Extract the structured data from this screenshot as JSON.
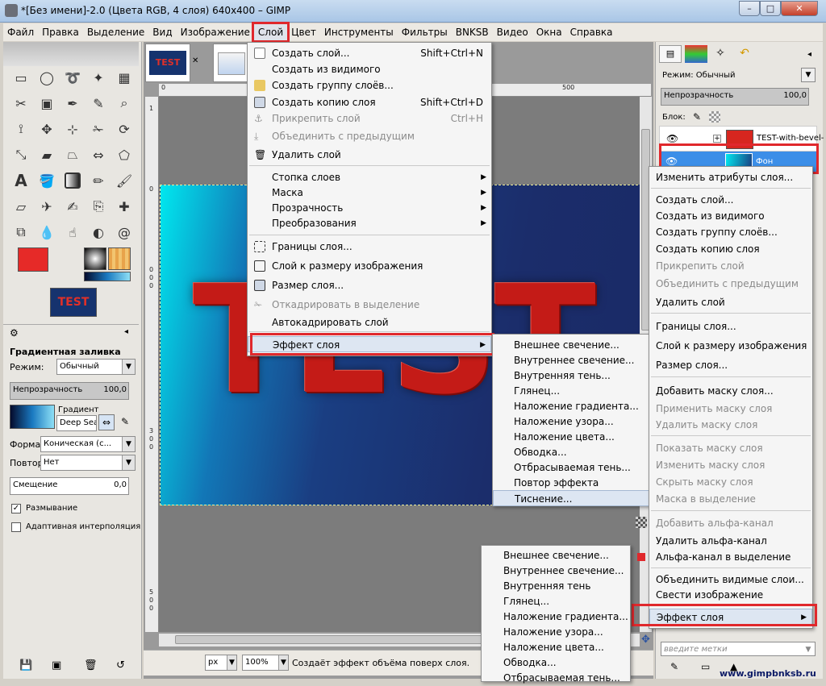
{
  "window": {
    "title": "*[Без имени]-2.0 (Цвета RGB, 4 слоя) 640x400 – GIMP",
    "min": "–",
    "max": "□",
    "close": "✕"
  },
  "menubar": [
    "Файл",
    "Правка",
    "Выделение",
    "Вид",
    "Изображение",
    "Слой",
    "Цвет",
    "Инструменты",
    "Фильтры",
    "BNKSB",
    "Видео",
    "Окна",
    "Справка"
  ],
  "canvas": {
    "image_text": "TEST",
    "ruler_h": [
      "0",
      "500"
    ],
    "ruler_v": [
      "1",
      "0",
      "0",
      "2",
      "0",
      "0",
      "3",
      "0",
      "0",
      "5",
      "0",
      "0"
    ],
    "tab_close": "✕"
  },
  "layer_menu": {
    "items": [
      {
        "label": "Создать слой...",
        "shortcut": "Shift+Ctrl+N"
      },
      {
        "label": "Создать из видимого",
        "shortcut": ""
      },
      {
        "label": "Создать группу слоёв...",
        "shortcut": ""
      },
      {
        "label": "Создать копию слоя",
        "shortcut": "Shift+Ctrl+D"
      },
      {
        "label": "Прикрепить слой",
        "shortcut": "Ctrl+H"
      },
      {
        "label": "Объединить с предыдущим",
        "shortcut": ""
      },
      {
        "label": "Удалить слой",
        "shortcut": ""
      },
      {
        "label": "Стопка слоев",
        "shortcut": ""
      },
      {
        "label": "Маска",
        "shortcut": ""
      },
      {
        "label": "Прозрачность",
        "shortcut": ""
      },
      {
        "label": "Преобразования",
        "shortcut": ""
      },
      {
        "label": "Границы слоя...",
        "shortcut": ""
      },
      {
        "label": "Слой к размеру изображения",
        "shortcut": ""
      },
      {
        "label": "Размер слоя...",
        "shortcut": ""
      },
      {
        "label": "Откадрировать в выделение",
        "shortcut": ""
      },
      {
        "label": "Автокадрировать слой",
        "shortcut": ""
      },
      {
        "label": "Эффект слоя",
        "shortcut": ""
      }
    ]
  },
  "effect_submenu_1": [
    "Внешнее свечение...",
    "Внутреннее свечение...",
    "Внутренняя тень...",
    "Глянец...",
    "Наложение градиента...",
    "Наложение узора...",
    "Наложение цвета...",
    "Обводка...",
    "Отбрасываемая тень...",
    "Повтор эффекта",
    "Тиснение..."
  ],
  "effect_submenu_2": [
    "Внешнее свечение...",
    "Внутреннее свечение...",
    "Внутренняя тень",
    "Глянец...",
    "Наложение градиента...",
    "Наложение узора...",
    "Наложение цвета...",
    "Обводка...",
    "Отбрасываемая тень..."
  ],
  "context_menu": [
    "Изменить атрибуты слоя...",
    "Создать слой...",
    "Создать из видимого",
    "Создать группу слоёв...",
    "Создать копию слоя",
    "Прикрепить слой",
    "Объединить с предыдущим",
    "Удалить слой",
    "Границы слоя...",
    "Слой к размеру изображения",
    "Размер слоя...",
    "Добавить маску слоя...",
    "Применить маску слоя",
    "Удалить маску слоя",
    "Показать маску слоя",
    "Изменить маску слоя",
    "Скрыть маску слоя",
    "Маска в выделение",
    "Добавить альфа-канал",
    "Удалить альфа-канал",
    "Альфа-канал в выделение",
    "Объединить видимые слои...",
    "Свести изображение",
    "Эффект слоя"
  ],
  "toolbox": {
    "thumb_text": "TEST",
    "tool_options_title": "Градиентная заливка",
    "mode_label": "Режим:",
    "mode_value": "Обычный",
    "opacity_label": "Непрозрачность",
    "opacity_value": "100,0",
    "gradient_label": "Градиент",
    "gradient_value": "Deep Sea",
    "shape_label": "Форма:",
    "shape_value": "Коническая (с...",
    "repeat_label": "Повтор:",
    "repeat_value": "Нет",
    "offset_label": "Смещение",
    "offset_value": "0,0",
    "dither_label": "Размывание",
    "adaptive_label": "Адаптивная интерполяция"
  },
  "layers_dock": {
    "mode_label": "Режим: Обычный",
    "opacity_label": "Непрозрачность",
    "opacity_value": "100,0",
    "lock_label": "Блок:",
    "layer1_name": "TEST-with-bevel-",
    "layer2_name": "Фон",
    "tags_placeholder": "введите метки"
  },
  "status": {
    "unit": "px",
    "zoom": "100%",
    "message": "Создаёт эффект объёма поверх слоя."
  },
  "watermark": "www.gimpbnksb.ru"
}
